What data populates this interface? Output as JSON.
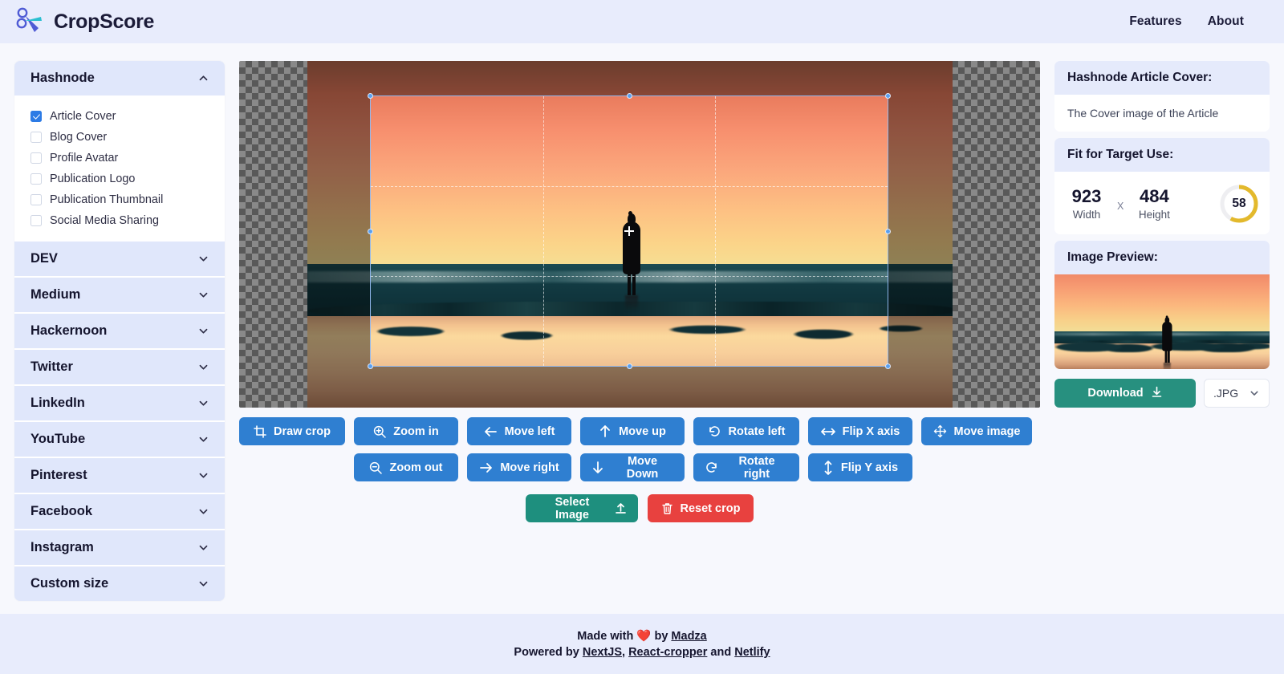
{
  "header": {
    "brand": "CropScore",
    "logo_icon": "scissors-icon",
    "nav": [
      {
        "label": "Features"
      },
      {
        "label": "About"
      }
    ]
  },
  "sidebar": {
    "groups": [
      {
        "label": "Hashnode",
        "expanded": true,
        "chevron": "chevron-up-icon",
        "options": [
          {
            "label": "Article Cover",
            "checked": true
          },
          {
            "label": "Blog Cover",
            "checked": false
          },
          {
            "label": "Profile Avatar",
            "checked": false
          },
          {
            "label": "Publication Logo",
            "checked": false
          },
          {
            "label": "Publication Thumbnail",
            "checked": false
          },
          {
            "label": "Social Media Sharing",
            "checked": false
          }
        ]
      },
      {
        "label": "DEV",
        "expanded": false,
        "chevron": "chevron-down-icon"
      },
      {
        "label": "Medium",
        "expanded": false,
        "chevron": "chevron-down-icon"
      },
      {
        "label": "Hackernoon",
        "expanded": false,
        "chevron": "chevron-down-icon"
      },
      {
        "label": "Twitter",
        "expanded": false,
        "chevron": "chevron-down-icon"
      },
      {
        "label": "LinkedIn",
        "expanded": false,
        "chevron": "chevron-down-icon"
      },
      {
        "label": "YouTube",
        "expanded": false,
        "chevron": "chevron-down-icon"
      },
      {
        "label": "Pinterest",
        "expanded": false,
        "chevron": "chevron-down-icon"
      },
      {
        "label": "Facebook",
        "expanded": false,
        "chevron": "chevron-down-icon"
      },
      {
        "label": "Instagram",
        "expanded": false,
        "chevron": "chevron-down-icon"
      },
      {
        "label": "Custom size",
        "expanded": false,
        "chevron": "chevron-down-icon"
      }
    ]
  },
  "toolbar": {
    "row1": [
      {
        "label": "Draw crop",
        "icon": "crop-icon",
        "color": "blue"
      },
      {
        "label": "Zoom in",
        "icon": "zoom-in-icon",
        "color": "blue"
      },
      {
        "label": "Move left",
        "icon": "arrow-left-icon",
        "color": "blue"
      },
      {
        "label": "Move up",
        "icon": "arrow-up-icon",
        "color": "blue"
      },
      {
        "label": "Rotate left",
        "icon": "rotate-left-icon",
        "color": "blue"
      },
      {
        "label": "Flip X axis",
        "icon": "flip-horizontal-icon",
        "color": "blue"
      },
      {
        "label": "Move image",
        "icon": "move-icon",
        "color": "blue"
      }
    ],
    "row2": [
      {
        "label": "Zoom out",
        "icon": "zoom-out-icon",
        "color": "blue"
      },
      {
        "label": "Move right",
        "icon": "arrow-right-icon",
        "color": "blue"
      },
      {
        "label": "Move Down",
        "icon": "arrow-down-icon",
        "color": "blue"
      },
      {
        "label": "Rotate right",
        "icon": "rotate-right-icon",
        "color": "blue"
      },
      {
        "label": "Flip Y axis",
        "icon": "flip-vertical-icon",
        "color": "blue"
      }
    ],
    "select_image": {
      "label": "Select Image",
      "icon": "upload-icon",
      "color": "teal"
    },
    "reset_crop": {
      "label": "Reset crop",
      "icon": "trash-icon",
      "color": "red"
    }
  },
  "right_panel": {
    "target_title": "Hashnode Article Cover:",
    "target_description": "The Cover image of the Article",
    "fit_title": "Fit for Target Use:",
    "width_value": "923",
    "width_label": "Width",
    "x_separator": "X",
    "height_value": "484",
    "height_label": "Height",
    "score": "58",
    "score_percent": 58,
    "score_color": "#e3b92c",
    "score_track_color": "#eeeef1",
    "preview_title": "Image Preview:",
    "download_label": "Download",
    "download_icon": "download-icon",
    "format_value": ".JPG",
    "format_chevron": "chevron-down-icon"
  },
  "footer": {
    "line1_prefix": "Made with ",
    "heart": "❤️",
    "line1_mid": " by ",
    "author": "Madza",
    "line2_prefix": "Powered by ",
    "tech1": "NextJS",
    "line2_sep1": ", ",
    "tech2": "React-cropper",
    "line2_sep2": " and ",
    "tech3": "Netlify"
  },
  "colors": {
    "accent_blue": "#2f7fd1",
    "teal": "#1e8f7e",
    "red": "#e8413f",
    "header_bg": "#e8ecfc",
    "panel_bg": "#e5eafb",
    "page_bg": "#f7f8fd",
    "text_dark": "#15152e"
  }
}
